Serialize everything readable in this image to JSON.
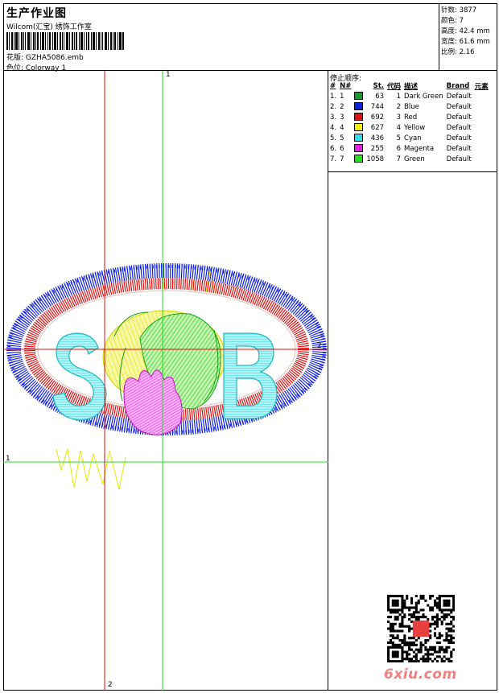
{
  "header": {
    "title": "生产作业图",
    "subtitle": "Wilcom(汇宝) 绣饰工作室",
    "design_label": "花版:",
    "design_value": "GZHA5086.emb",
    "colorway_label": "色位:",
    "colorway_value": "Colorway 1"
  },
  "stats": [
    {
      "label": "针数:",
      "value": "3877"
    },
    {
      "label": "颜色:",
      "value": "7"
    },
    {
      "label": "高度:",
      "value": "42.4 mm"
    },
    {
      "label": "宽度:",
      "value": "61.6 mm"
    },
    {
      "label": "比例:",
      "value": "2.16"
    }
  ],
  "stop_sequence": {
    "title": "停止顺序:",
    "headers": [
      "#",
      "N#",
      "St.",
      "代码",
      "描述",
      "Brand",
      "元素"
    ],
    "rows": [
      {
        "num": "1.",
        "n": "1",
        "color": "#1a9a2a",
        "st": "63",
        "code": "1",
        "desc": "Dark Green",
        "brand": "Default"
      },
      {
        "num": "2.",
        "n": "2",
        "color": "#1020e0",
        "st": "744",
        "code": "2",
        "desc": "Blue",
        "brand": "Default"
      },
      {
        "num": "3.",
        "n": "3",
        "color": "#e01010",
        "st": "692",
        "code": "3",
        "desc": "Red",
        "brand": "Default"
      },
      {
        "num": "4.",
        "n": "4",
        "color": "#f0f000",
        "st": "627",
        "code": "4",
        "desc": "Yellow",
        "brand": "Default"
      },
      {
        "num": "5.",
        "n": "5",
        "color": "#30e0e8",
        "st": "436",
        "code": "5",
        "desc": "Cyan",
        "brand": "Default"
      },
      {
        "num": "6.",
        "n": "6",
        "color": "#e020e0",
        "st": "255",
        "code": "6",
        "desc": "Magenta",
        "brand": "Default"
      },
      {
        "num": "7.",
        "n": "7",
        "color": "#20e020",
        "st": "1058",
        "code": "7",
        "desc": "Green",
        "brand": "Default"
      }
    ]
  },
  "guides": {
    "green_v": "1",
    "green_h": "1",
    "red_h": "2",
    "red_v": "2"
  },
  "design_letters": [
    "S",
    "B"
  ],
  "watermark": "6xiu.com"
}
